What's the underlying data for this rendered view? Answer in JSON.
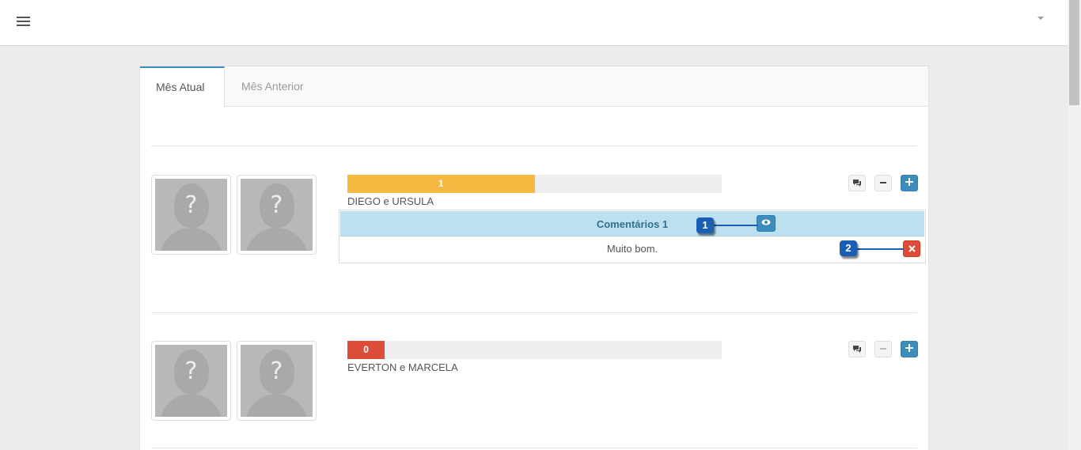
{
  "header": {
    "menu_icon": "hamburger-icon",
    "user_menu_icon": "caret-down-icon"
  },
  "tabs": [
    {
      "label": "Mês Atual",
      "active": true
    },
    {
      "label": "Mês Anterior",
      "active": false
    }
  ],
  "entries": [
    {
      "names": "DIEGO e URSULA",
      "score": "1",
      "progress_pct": 50,
      "bar_color": "#f5b942",
      "comments": {
        "header": "Comentários 1",
        "items": [
          {
            "text": "Muito bom."
          }
        ]
      }
    },
    {
      "names": "EVERTON e MARCELA",
      "score": "0",
      "progress_pct": 10,
      "bar_color": "#dd4b39"
    }
  ],
  "annotations": [
    "1",
    "2"
  ],
  "colors": {
    "primary": "#3c8dbc",
    "danger": "#dd4b39",
    "warning": "#f5b942",
    "info_bg": "#bde0f1"
  }
}
